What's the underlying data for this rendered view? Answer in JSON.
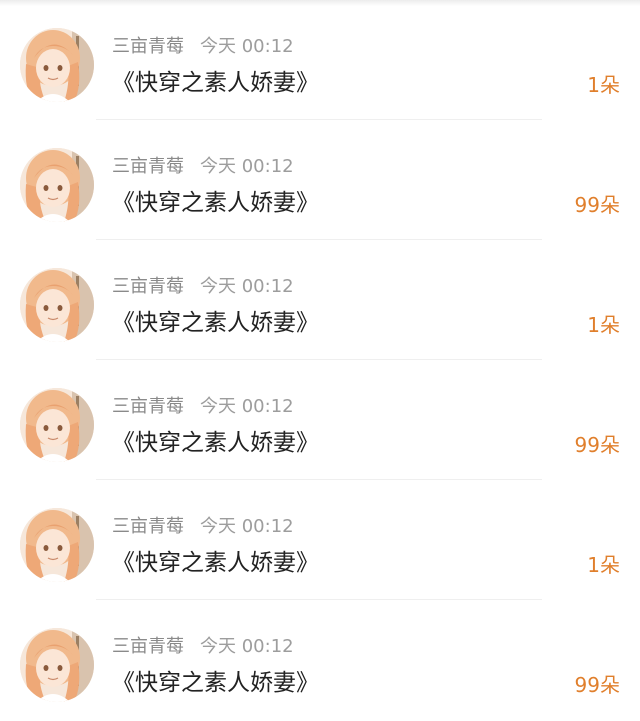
{
  "comments": [
    {
      "username": "三亩青莓",
      "time": "今天 00:12",
      "content": "《快穿之素人娇妻》",
      "gift": "1朵"
    },
    {
      "username": "三亩青莓",
      "time": "今天 00:12",
      "content": "《快穿之素人娇妻》",
      "gift": "99朵"
    },
    {
      "username": "三亩青莓",
      "time": "今天 00:12",
      "content": "《快穿之素人娇妻》",
      "gift": "1朵"
    },
    {
      "username": "三亩青莓",
      "time": "今天 00:12",
      "content": "《快穿之素人娇妻》",
      "gift": "99朵"
    },
    {
      "username": "三亩青莓",
      "time": "今天 00:12",
      "content": "《快穿之素人娇妻》",
      "gift": "1朵"
    },
    {
      "username": "三亩青莓",
      "time": "今天 00:12",
      "content": "《快穿之素人娇妻》",
      "gift": "99朵"
    }
  ],
  "colors": {
    "gift_accent": "#e07f2c",
    "username": "#8a8a8a",
    "content": "#222222"
  },
  "icons": {
    "avatar": "anime-girl-avatar"
  }
}
